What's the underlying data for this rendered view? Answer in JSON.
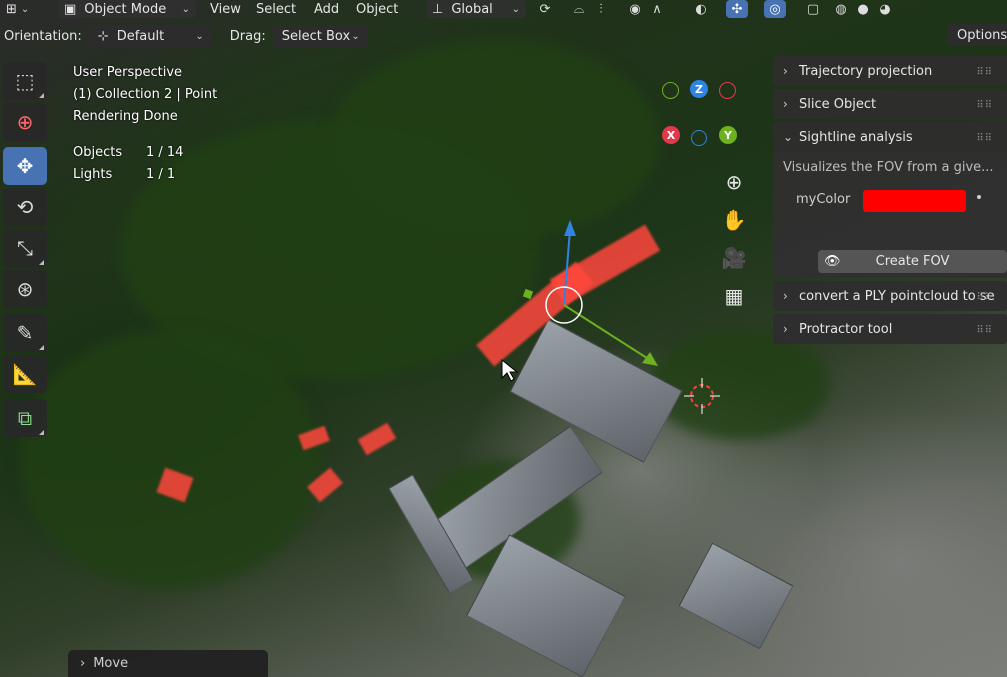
{
  "header": {
    "editor_type_icon": "viewport-icon",
    "mode": "Object Mode",
    "menus": [
      "View",
      "Select",
      "Add",
      "Object"
    ],
    "transform_orientation": "Global"
  },
  "tool_settings": {
    "orientation_label": "Orientation:",
    "orientation_value": "Default",
    "drag_label": "Drag:",
    "drag_value": "Select Box",
    "options_label": "Options"
  },
  "toolbar": {
    "tools": [
      {
        "name": "select-box-icon"
      },
      {
        "name": "cursor-icon"
      },
      {
        "name": "move-icon"
      },
      {
        "name": "rotate-icon"
      },
      {
        "name": "scale-icon"
      },
      {
        "name": "transform-icon"
      },
      {
        "name": "annotate-icon"
      },
      {
        "name": "measure-icon"
      },
      {
        "name": "add-cube-icon"
      }
    ]
  },
  "overlay": {
    "view_name": "User Perspective",
    "collection": "(1) Collection 2 | Point",
    "status": "Rendering Done",
    "objects_label": "Objects",
    "objects_value": "1 / 14",
    "lights_label": "Lights",
    "lights_value": "1 / 1"
  },
  "gizmo": {
    "x": "X",
    "y": "Y",
    "z": "Z",
    "colors": {
      "x": "#e2384d",
      "y": "#6cb11f",
      "z": "#2f83e3"
    }
  },
  "sidebar": {
    "panels": [
      {
        "label": "Trajectory projection",
        "expanded": false
      },
      {
        "label": "Slice Object",
        "expanded": false
      },
      {
        "label": "Sightline analysis",
        "expanded": true
      },
      {
        "label": "convert a PLY pointcloud to se",
        "expanded": false
      },
      {
        "label": "Protractor tool",
        "expanded": false
      }
    ],
    "sightline": {
      "description": "Visualizes the FOV from a give...",
      "color_label": "myColor",
      "color_value": "#ff0000",
      "button_label": "Create FOV"
    }
  },
  "redo_panel": {
    "label": "Move"
  }
}
